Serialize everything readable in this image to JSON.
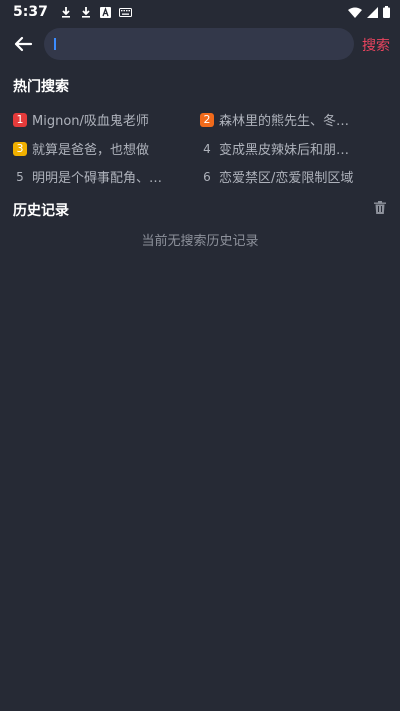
{
  "status_bar": {
    "time": "5:37",
    "icons_left": [
      "download-icon",
      "download-icon",
      "a-app-icon",
      "keyboard-icon"
    ],
    "icons_right": [
      "wifi-icon",
      "signal-icon",
      "battery-icon"
    ]
  },
  "search": {
    "placeholder": "",
    "value": "",
    "submit_label": "搜索"
  },
  "hot_search": {
    "title": "热门搜索",
    "items": [
      {
        "rank": "1",
        "text": "Mignon/吸血鬼老师",
        "badge_color": "#e53b3b"
      },
      {
        "rank": "2",
        "text": "森林里的熊先生、冬…",
        "badge_color": "#f06a1b"
      },
      {
        "rank": "3",
        "text": "就算是爸爸，也想做",
        "badge_color": "#f0b000"
      },
      {
        "rank": "4",
        "text": "变成黑皮辣妹后和朋…",
        "badge_color": ""
      },
      {
        "rank": "5",
        "text": "明明是个碍事配角、…",
        "badge_color": ""
      },
      {
        "rank": "6",
        "text": "恋爱禁区/恋爱限制区域",
        "badge_color": ""
      }
    ]
  },
  "history": {
    "title": "历史记录",
    "empty_text": "当前无搜索历史记录",
    "clear_icon": "trash-icon"
  },
  "colors": {
    "background": "#262a35",
    "search_box": "#33384a",
    "accent": "#e9445e"
  }
}
